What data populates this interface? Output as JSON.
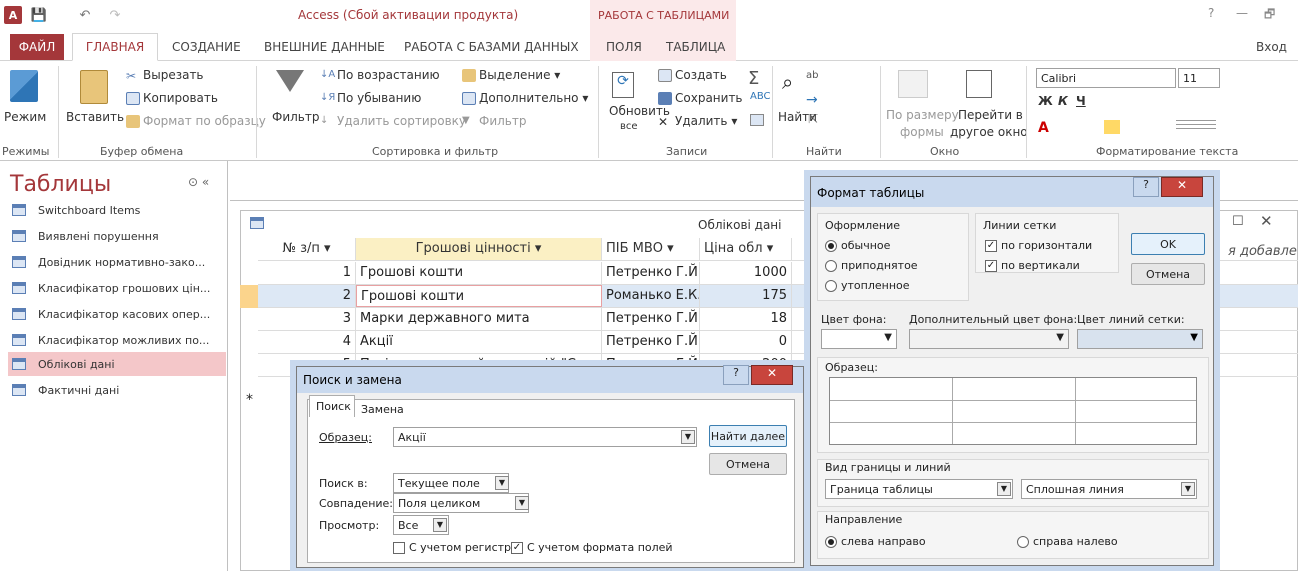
{
  "window": {
    "title": "Access (Сбой активации продукта)",
    "context_header": "РАБОТА С ТАБЛИЦАМИ",
    "signin": "Вход",
    "help": "?",
    "minimize": "—",
    "restore": "🗗"
  },
  "quick_access": {
    "logo": "A",
    "save": "💾",
    "undo": "↶",
    "redo": "↷"
  },
  "tabs": [
    "ФАЙЛ",
    "ГЛАВНАЯ",
    "СОЗДАНИЕ",
    "ВНЕШНИЕ ДАННЫЕ",
    "РАБОТА С БАЗАМИ ДАННЫХ",
    "ПОЛЯ",
    "ТАБЛИЦА"
  ],
  "ribbon": {
    "modes": {
      "btn": "Режим",
      "group": "Режимы"
    },
    "clipboard": {
      "paste": "Вставить",
      "cut": "Вырезать",
      "copy": "Копировать",
      "format": "Формат по образцу",
      "group": "Буфер обмена"
    },
    "sort": {
      "filter": "Фильтр",
      "asc": "По возрастанию",
      "desc": "По убыванию",
      "clear": "Удалить сортировку",
      "selection": "Выделение",
      "advanced": "Дополнительно",
      "toggle": "Фильтр",
      "group": "Сортировка и фильтр"
    },
    "records": {
      "refresh": "Обновить",
      "refresh2": "все",
      "new": "Создать",
      "save": "Сохранить",
      "delete": "Удалить",
      "group": "Записи"
    },
    "find": {
      "find": "Найти",
      "group": "Найти"
    },
    "window": {
      "size": "По размеру",
      "size2": "формы",
      "switch": "Перейти в",
      "switch2": "другое окно",
      "group": "Окно"
    },
    "text": {
      "font": "Calibri",
      "size": "11",
      "group": "Форматирование текста",
      "bold": "Ж",
      "italic": "К",
      "underline": "Ч"
    }
  },
  "nav": {
    "title": "Таблицы",
    "items": [
      "Switchboard Items",
      "Виявлені порушення",
      "Довідник нормативно-зако...",
      "Класифікатор грошових цін...",
      "Класифікатор касових опер...",
      "Класифікатор можливих по...",
      "Облікові дані",
      "Фактичні дані"
    ],
    "selected": 6
  },
  "sheet": {
    "title": "Облікові дані",
    "headers": [
      "№ з/п",
      "Грошові цінності",
      "ПІБ МВО",
      "Ціна обл"
    ],
    "rows": [
      [
        "1",
        "Грошові кошти",
        "Петренко Г.Й.",
        "1000"
      ],
      [
        "2",
        "Грошові кошти",
        "Романько Е.К.",
        "175"
      ],
      [
        "3",
        "Марки державного мита",
        "Петренко Г.Й.",
        "18"
      ],
      [
        "4",
        "Акції",
        "Петренко Г.Й.",
        "0"
      ],
      [
        "5",
        "Путівки в литячий санаторій \"Сонечко\"",
        "Петренко Г.Й.",
        "200"
      ]
    ],
    "right_header": "я добавле",
    "new_row": "*"
  },
  "find_dialog": {
    "title": "Поиск и замена",
    "tab_find": "Поиск",
    "tab_replace": "Замена",
    "pattern_label": "Образец:",
    "pattern_value": "Акції",
    "find_next": "Найти далее",
    "cancel": "Отмена",
    "lookin_label": "Поиск в:",
    "lookin_value": "Текущее поле",
    "match_label": "Совпадение:",
    "match_value": "Поля целиком",
    "search_label": "Просмотр:",
    "search_value": "Все",
    "match_case": "С учетом регистра",
    "match_format": "С учетом формата полей"
  },
  "format_dialog": {
    "title": "Формат таблицы",
    "appearance_label": "Оформление",
    "appearance": [
      "обычное",
      "приподнятое",
      "утопленное"
    ],
    "grid_label": "Линии сетки",
    "grid_h": "по горизонтали",
    "grid_v": "по вертикали",
    "ok": "OK",
    "cancel": "Отмена",
    "bg_label": "Цвет фона:",
    "alt_bg_label": "Дополнительный цвет фона:",
    "gridcolor_label": "Цвет линий сетки:",
    "sample_label": "Образец:",
    "border_label": "Вид границы и линий",
    "border_value": "Граница таблицы",
    "line_value": "Сплошная линия",
    "direction_label": "Направление",
    "ltr": "слева направо",
    "rtl": "справа налево"
  }
}
